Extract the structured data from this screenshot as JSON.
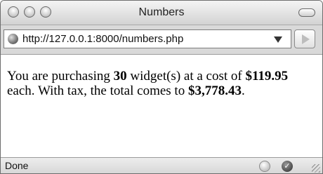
{
  "window": {
    "title": "Numbers"
  },
  "toolbar": {
    "url": "http://127.0.0.1:8000/numbers.php"
  },
  "content": {
    "part1": "You are purchasing ",
    "quantity": "30",
    "part2": " widget(s) at a cost of ",
    "price": "$119.95",
    "part3": " each. With tax, the total comes to ",
    "total": "$3,778.43",
    "part4": "."
  },
  "status": {
    "text": "Done"
  },
  "icons": {
    "close": "close-icon",
    "minimize": "minimize-icon",
    "zoom": "zoom-icon",
    "toolbar_toggle": "toolbar-toggle-icon",
    "globe": "globe-icon",
    "dropdown": "dropdown-arrow-icon",
    "go": "play-arrow-icon",
    "status_1": "circle-indicator-icon",
    "status_2": "checkmark-icon",
    "resize": "resize-grip-icon"
  }
}
